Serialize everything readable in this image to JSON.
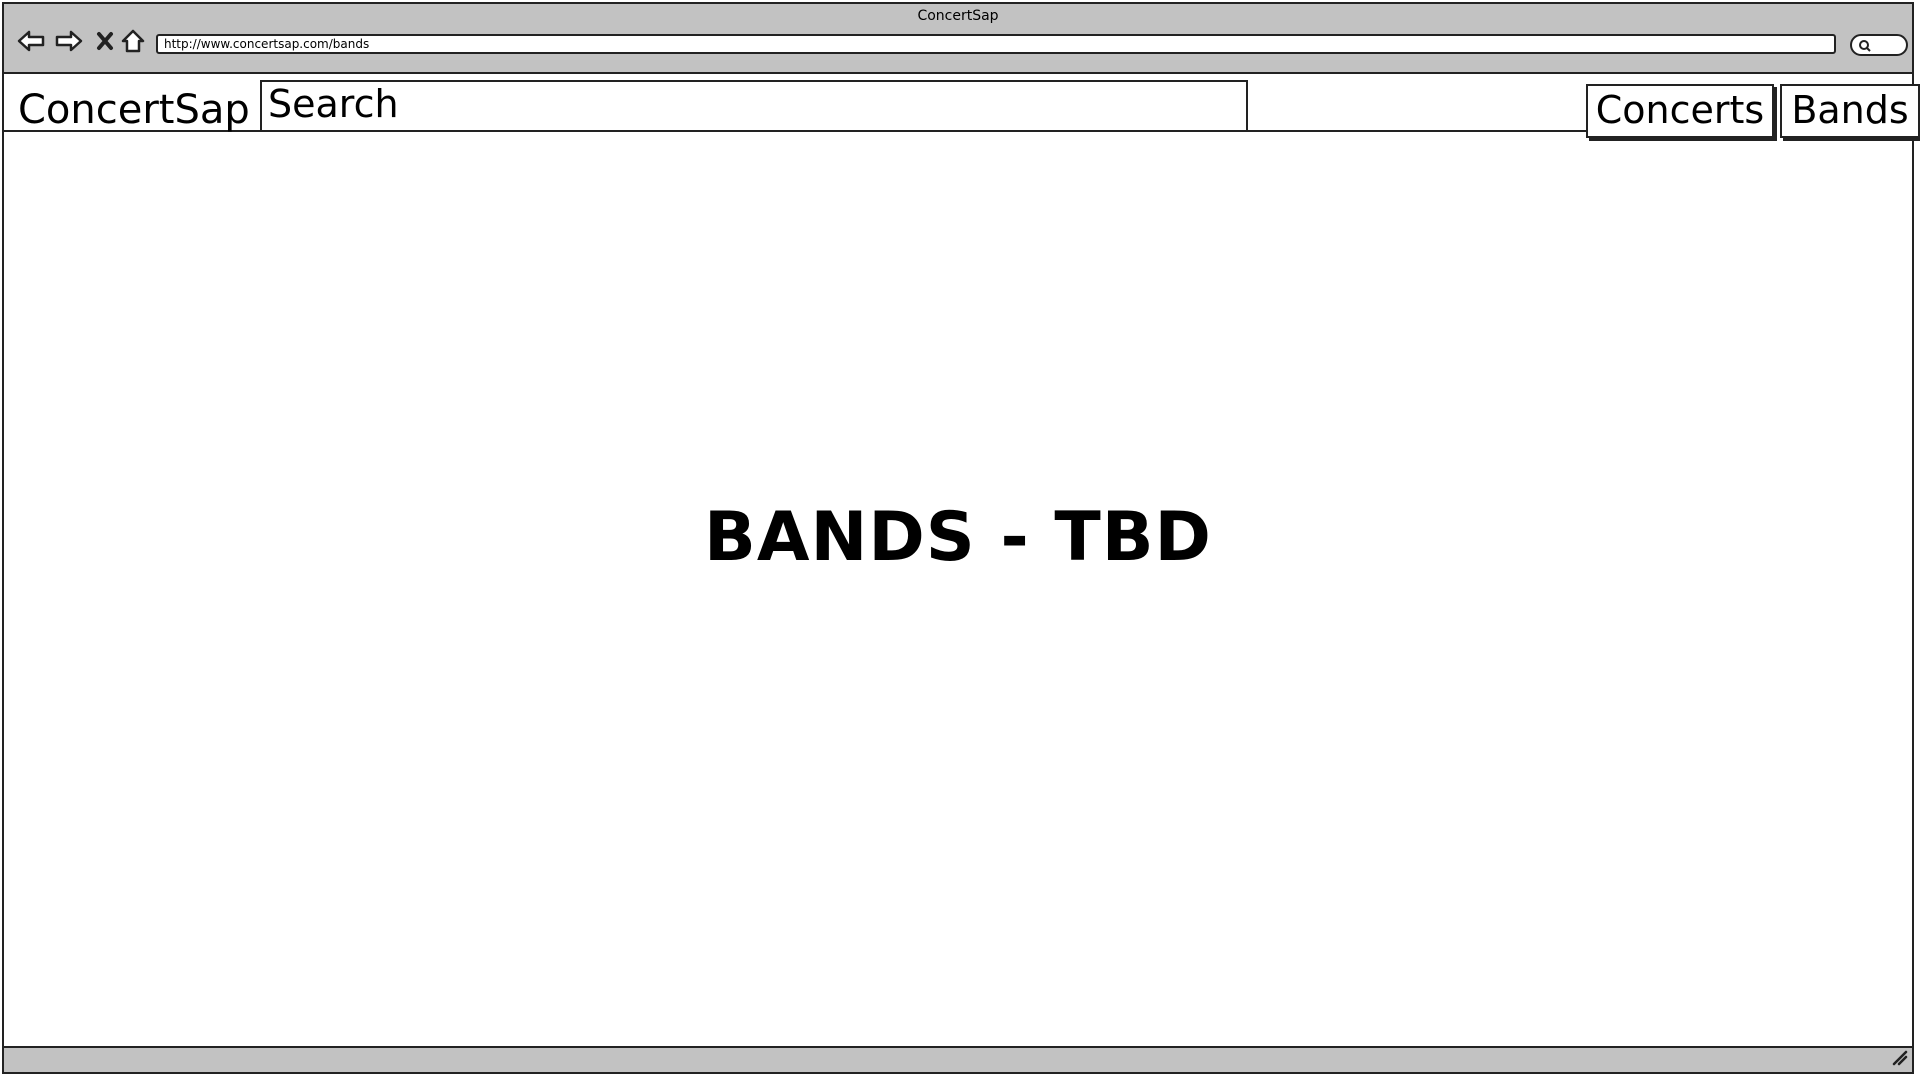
{
  "browser": {
    "window_title": "ConcertSap",
    "url": "http://www.concertsap.com/bands",
    "icons": {
      "back": "back-arrow-icon",
      "forward": "forward-arrow-icon",
      "stop": "close-icon",
      "home": "home-icon",
      "search": "search-icon",
      "resize": "resize-grip-icon"
    }
  },
  "header": {
    "logo": "ConcertSap",
    "search_placeholder": "Search",
    "nav": {
      "concerts_label": "Concerts",
      "bands_label": "Bands"
    }
  },
  "main": {
    "heading": "BANDS - TBD"
  }
}
